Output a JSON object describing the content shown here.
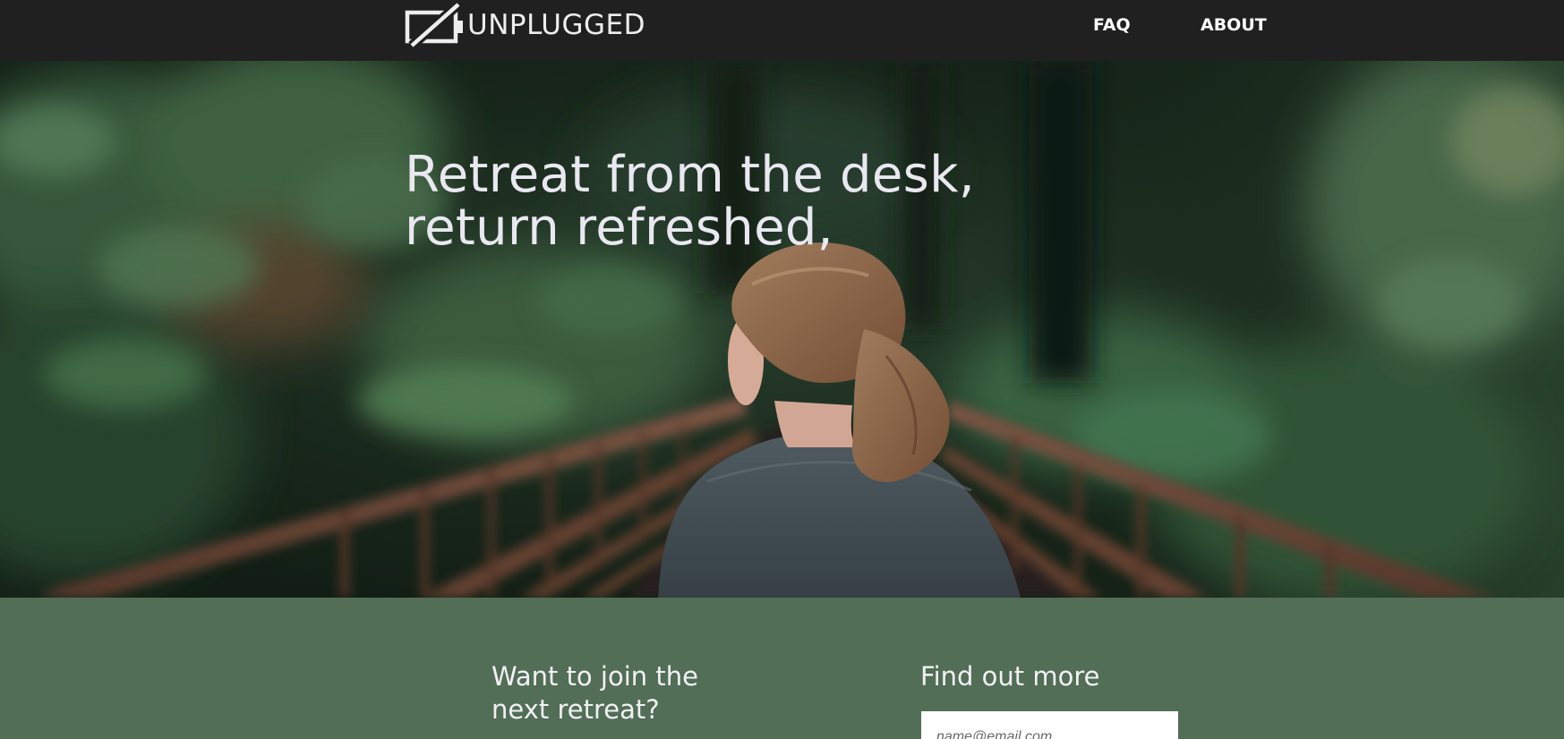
{
  "nav": {
    "logo": {
      "text": "UNPLUGGED",
      "icon": "unplugged-battery-icon"
    },
    "links": [
      {
        "label": "FAQ"
      },
      {
        "label": "ABOUT"
      }
    ]
  },
  "hero": {
    "headline_line1": "Retreat from the desk,",
    "headline_line2": "return refreshed,",
    "image": "woman-on-forest-bridge-photo"
  },
  "signup": {
    "join_line1": "Want to join the",
    "join_line2": "next retreat?",
    "find_out_more": "Find out more",
    "email_placeholder": "name@email.com"
  },
  "colors": {
    "nav_bg": "#202020",
    "band_bg": "#526e56",
    "headline_text": "#e9e8f0"
  }
}
